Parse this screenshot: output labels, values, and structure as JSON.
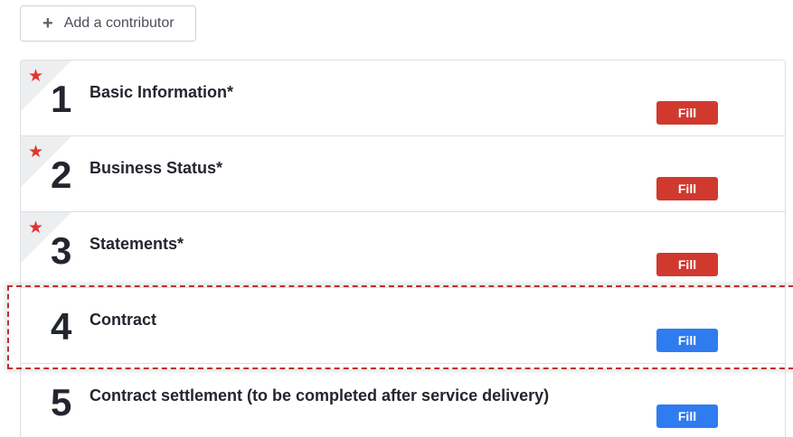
{
  "add_contributor": {
    "icon": "plus-icon",
    "label": "Add a contributor"
  },
  "sections": [
    {
      "number": "1",
      "title": "Basic Information*",
      "required": true,
      "button_label": "Fill",
      "button_color": "#d1392f"
    },
    {
      "number": "2",
      "title": "Business Status*",
      "required": true,
      "button_label": "Fill",
      "button_color": "#d1392f"
    },
    {
      "number": "3",
      "title": "Statements*",
      "required": true,
      "button_label": "Fill",
      "button_color": "#d1392f"
    },
    {
      "number": "4",
      "title": "Contract",
      "required": false,
      "button_label": "Fill",
      "button_color": "#2f7cf0"
    },
    {
      "number": "5",
      "title": "Contract settlement (to be completed after service delivery)",
      "required": false,
      "button_label": "Fill",
      "button_color": "#2f7cf0"
    }
  ],
  "colors": {
    "required_star": "#e0342c",
    "highlight_border": "#c0302b"
  }
}
